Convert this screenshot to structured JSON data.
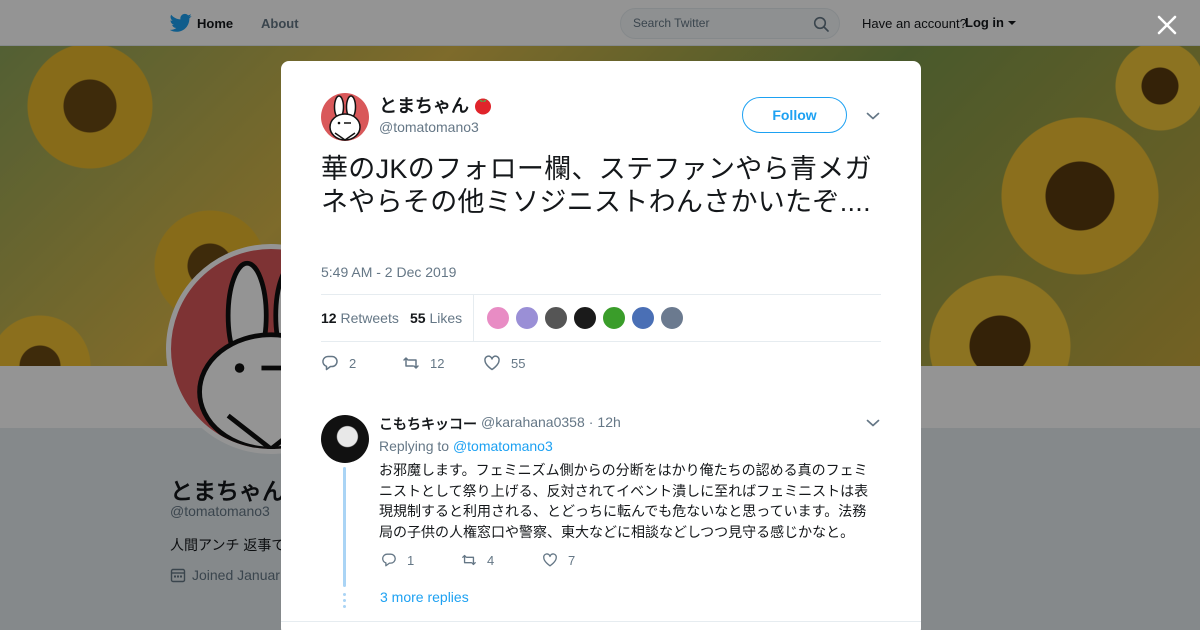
{
  "nav": {
    "home_label": "Home",
    "about_label": "About",
    "search_placeholder": "Search Twitter",
    "have_account": "Have an account?",
    "login_label": "Log in"
  },
  "profile": {
    "name": "とまちゃん",
    "handle": "@tomatomano3",
    "bio": "人間アンチ 返事で",
    "joined": "Joined Januar"
  },
  "tweet": {
    "author_name": "とまちゃん",
    "author_handle": "@tomatomano3",
    "follow_label": "Follow",
    "text": "華のJKのフォロー欄、ステファンやら青メガネやらその他ミソジニストわんさかいたぞ....",
    "timestamp": "5:49 AM - 2 Dec 2019",
    "retweets_count": "12",
    "retweets_label": "Retweets",
    "likes_count": "55",
    "likes_label": "Likes",
    "likers": [
      "#e88cc4",
      "#9a8fd6",
      "#555555",
      "#1a1a1a",
      "#3a9d2a",
      "#4a6fb5",
      "#6b7a8f"
    ],
    "actions": {
      "replies": "2",
      "retweets": "12",
      "likes": "55"
    }
  },
  "reply": {
    "author_name": "こもちキッコー",
    "author_handle": "@karahana0358",
    "separator": "·",
    "time": "12h",
    "replying_prefix": "Replying to",
    "replying_to": "@tomatomano3",
    "text": "お邪魔します。フェミニズム側からの分断をはかり俺たちの認める真のフェミニストとして祭り上げる、反対されてイベント潰しに至ればフェミニストは表現規制すると利用される、とどっちに転んでも危ないなと思っています。法務局の子供の人権窓口や警察、東大などに相談などしつつ見守る感じかなと。",
    "actions": {
      "replies": "1",
      "retweets": "4",
      "likes": "7"
    },
    "more_replies": "3 more replies"
  },
  "colors": {
    "accent": "#1da1f2",
    "text": "#14171a",
    "muted": "#657786",
    "border": "#e6ecf0"
  }
}
